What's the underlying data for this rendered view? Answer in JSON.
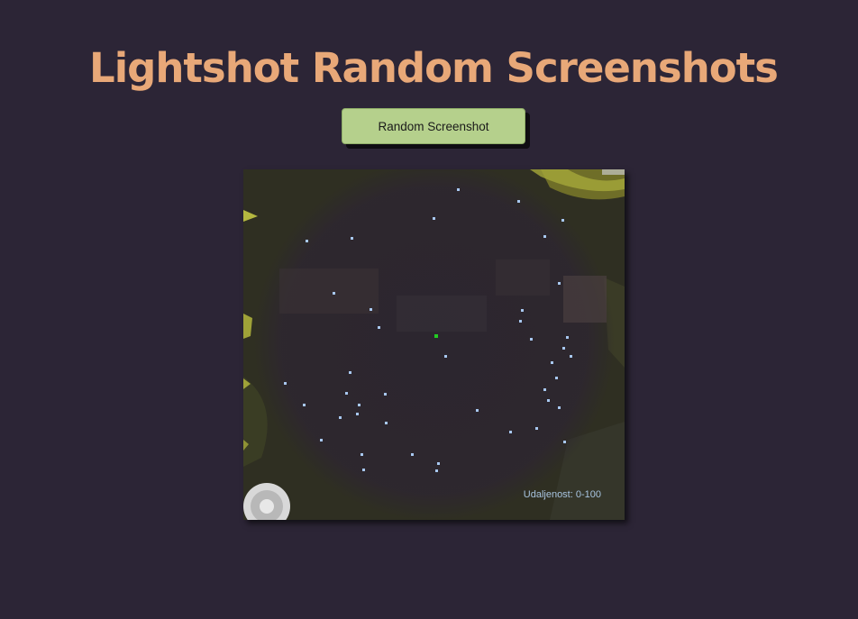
{
  "page": {
    "title": "Lightshot Random Screenshots"
  },
  "controls": {
    "random_button_label": "Random Screenshot"
  },
  "screenshot": {
    "radius_label": "Udaljenost: 0-100",
    "player_marker_color": "#22cc22",
    "unit_marker_color": "#a8c8f0"
  }
}
